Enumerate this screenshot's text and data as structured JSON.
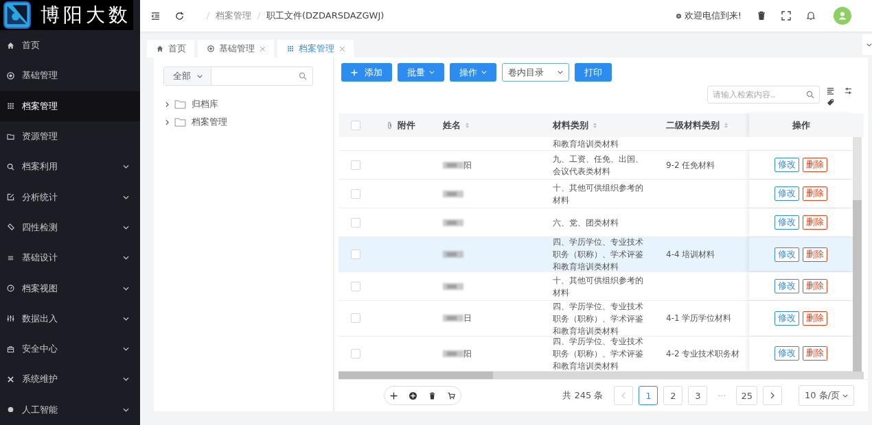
{
  "logo": {
    "text": "博阳大数"
  },
  "sidebar": {
    "items": [
      {
        "label": "首页",
        "expandable": false,
        "selected": false
      },
      {
        "label": "基础管理",
        "expandable": false,
        "selected": false
      },
      {
        "label": "档案管理",
        "expandable": false,
        "selected": true
      },
      {
        "label": "资源管理",
        "expandable": false,
        "selected": false
      },
      {
        "label": "档案利用",
        "expandable": true,
        "selected": false
      },
      {
        "label": "分析统计",
        "expandable": true,
        "selected": false
      },
      {
        "label": "四性检测",
        "expandable": true,
        "selected": false
      },
      {
        "label": "基础设计",
        "expandable": true,
        "selected": false
      },
      {
        "label": "档案视图",
        "expandable": true,
        "selected": false
      },
      {
        "label": "数据出入",
        "expandable": true,
        "selected": false
      },
      {
        "label": "安全中心",
        "expandable": true,
        "selected": false
      },
      {
        "label": "系统维护",
        "expandable": true,
        "selected": false
      },
      {
        "label": "人工智能",
        "expandable": true,
        "selected": false
      }
    ]
  },
  "header": {
    "breadcrumb": [
      "档案管理",
      "职工文件(DZDARSDAZGWJ)"
    ],
    "welcome": "欢迎电信到来!"
  },
  "tabs": [
    {
      "label": "首页",
      "closable": false,
      "selected": false
    },
    {
      "label": "基础管理",
      "closable": true,
      "selected": false
    },
    {
      "label": "档案管理",
      "closable": true,
      "selected": true
    }
  ],
  "tree": {
    "scope": "全部",
    "items": [
      {
        "label": "归档库"
      },
      {
        "label": "档案管理"
      }
    ]
  },
  "toolbar": {
    "buttons": [
      {
        "label": "添加",
        "kind": "add"
      },
      {
        "label": "批量",
        "kind": "dropdown"
      },
      {
        "label": "操作",
        "kind": "dropdown"
      },
      {
        "label": "卷内目录",
        "kind": "select"
      },
      {
        "label": "打印",
        "kind": "plain"
      }
    ],
    "search": {
      "placeholder": "请输入检索内容.."
    }
  },
  "table": {
    "columns": [
      "附件",
      "姓名",
      "材料类别",
      "二级材料类别",
      "操作"
    ],
    "all_checked": false,
    "rows": [
      {
        "kind": "partial",
        "name": "",
        "category": "和教育培训类材料",
        "subcategory": "",
        "selected": false,
        "actions": []
      },
      {
        "kind": "full",
        "name": "阳",
        "blurred": true,
        "category": "九、工资、任免、出国、会议代表类材料",
        "subcategory": "9-2 任免材料",
        "selected": false,
        "checked": false,
        "actions": [
          "修改",
          "删除"
        ]
      },
      {
        "kind": "full",
        "name": "",
        "blurred": true,
        "category": "十、其他可供组织参考的材料",
        "subcategory": "",
        "selected": false,
        "checked": false,
        "actions": [
          "修改",
          "删除"
        ]
      },
      {
        "kind": "full",
        "name": "",
        "blurred": true,
        "category": "六、党、团类材料",
        "subcategory": "",
        "selected": false,
        "checked": false,
        "actions": [
          "修改",
          "删除"
        ]
      },
      {
        "kind": "full",
        "name": "",
        "blurred": true,
        "category": "四、学历学位、专业技术职务（职称）、学术评鉴和教育培训类材料",
        "subcategory": "4-4 培训材料",
        "selected": true,
        "checked": false,
        "actions": [
          "修改",
          "删除"
        ]
      },
      {
        "kind": "full",
        "name": "",
        "blurred": true,
        "category": "十、其他可供组织参考的材料",
        "subcategory": "",
        "selected": false,
        "checked": false,
        "actions": [
          "修改",
          "删除"
        ]
      },
      {
        "kind": "full",
        "name": "日",
        "blurred": true,
        "category": "四、学历学位、专业技术职务（职称）、学术评鉴和教育培训类材料",
        "subcategory": "4-1 学历学位材料",
        "selected": false,
        "checked": false,
        "actions": [
          "修改",
          "删除"
        ]
      },
      {
        "kind": "full",
        "name": "阳",
        "blurred": true,
        "category": "四、学历学位、专业技术职务（职称）、学术评鉴和教育培训类材料",
        "subcategory": "4-2 专业技术职务材",
        "selected": false,
        "checked": false,
        "actions": [
          "修改",
          "删除"
        ]
      }
    ]
  },
  "pagination": {
    "total": "共 245 条",
    "pages": [
      {
        "label": "1",
        "selected": true
      },
      {
        "label": "2",
        "selected": false
      },
      {
        "label": "3",
        "selected": false
      },
      {
        "label": "25",
        "selected": false
      }
    ],
    "ellipsis": "···",
    "page_size": "10 条/页"
  }
}
